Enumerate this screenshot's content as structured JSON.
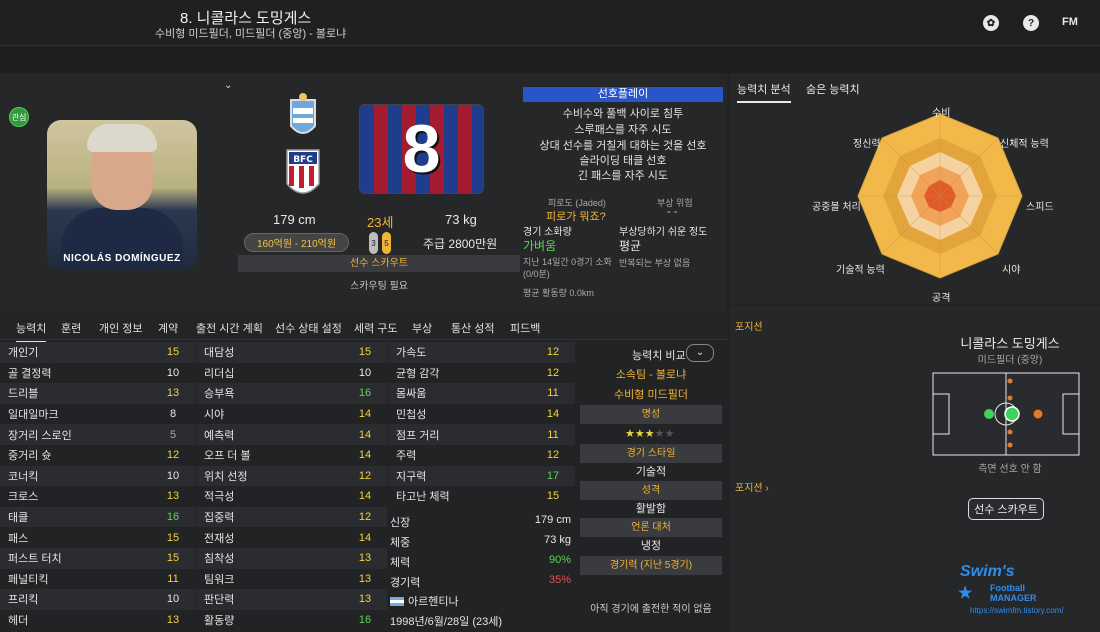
{
  "header": {
    "title": "8. 니콜라스 도밍게스",
    "subtitle": "수비형 미드필더, 미드필더 (중앙) - 볼로냐",
    "icons": [
      "award-icon",
      "help-icon",
      "fm-icon"
    ],
    "fm_label": "FM"
  },
  "profile": {
    "badge": "관심",
    "portrait_name": "NICOLÁS DOMÍNGUEZ",
    "shirt_number": "8",
    "height": "179 cm",
    "age": "23세",
    "weight": "73 kg",
    "value": "160억원 - 210억원",
    "reputation": [
      "3",
      "5"
    ],
    "wage": "주급 2800만원",
    "scout_label": "선수 스카우트",
    "scout_need": "스카우팅 필요"
  },
  "preferred_moves": {
    "title": "선호플레이",
    "items": [
      "수비수와 풀백 사이로 침투",
      "스루패스를 자주 시도",
      "상대 선수를 거칠게 대하는 것을 선호",
      "슬라이딩 태클 선호",
      "긴 패스를 자주 시도"
    ]
  },
  "status": {
    "fatigue_label": "피로도 (Jaded)",
    "fatigue_value": "피로가 뭐죠?",
    "injury_risk_label": "부상 위험",
    "injury_risk_value": "- -",
    "match_load_label": "경기 소화량",
    "match_load_value": "가벼움",
    "injury_prone_label": "부상당하기 쉬운 정도",
    "injury_prone_value": "평균",
    "recent_label": "지난 14일간 0경기 소화(0/0분)",
    "recurring_label": "반복되는 부상 없음",
    "avg_distance": "평균 활동량 0.0km"
  },
  "right_tabs": [
    "능력치 분석",
    "숨은 능력치"
  ],
  "radar_labels": {
    "defending": "수비",
    "physical": "신체적 능력",
    "speed": "스피드",
    "vision": "시야",
    "attacking": "공격",
    "technique": "기술적 능력",
    "aerial": "공중볼 처리",
    "mental": "정신력"
  },
  "positions": {
    "title": "포지션",
    "player_name": "니콜라스 도밍게스",
    "role": "미드필더 (중앙)",
    "note": "측면 선호 안 함",
    "title2": "포지션 ›",
    "scout_button": "선수 스카우트"
  },
  "logo": {
    "line1": "Swim's",
    "line2": "Football",
    "line3": "MANAGER",
    "url": "https://swimfm.tistory.com/"
  },
  "tabs": [
    "능력치",
    "훈련",
    "개인 정보",
    "계약",
    "출전 시간 계획",
    "선수 상태 설정",
    "세력 구도",
    "부상",
    "통산 성적",
    "피드백"
  ],
  "technical": [
    {
      "name": "개인기",
      "value": "15"
    },
    {
      "name": "골 결정력",
      "value": "10"
    },
    {
      "name": "드리블",
      "value": "13"
    },
    {
      "name": "일대일마크",
      "value": "8"
    },
    {
      "name": "장거리 스로인",
      "value": "5"
    },
    {
      "name": "중거리 슛",
      "value": "12"
    },
    {
      "name": "코너킥",
      "value": "10"
    },
    {
      "name": "크로스",
      "value": "13"
    },
    {
      "name": "태클",
      "value": "16"
    },
    {
      "name": "패스",
      "value": "15"
    },
    {
      "name": "퍼스트 터치",
      "value": "15"
    },
    {
      "name": "페널티킥",
      "value": "11"
    },
    {
      "name": "프리킥",
      "value": "10"
    },
    {
      "name": "헤더",
      "value": "13"
    }
  ],
  "mental": [
    {
      "name": "대담성",
      "value": "15"
    },
    {
      "name": "리더십",
      "value": "10"
    },
    {
      "name": "승부욕",
      "value": "16"
    },
    {
      "name": "시야",
      "value": "14"
    },
    {
      "name": "예측력",
      "value": "14"
    },
    {
      "name": "오프 더 볼",
      "value": "14"
    },
    {
      "name": "위치 선정",
      "value": "12"
    },
    {
      "name": "적극성",
      "value": "14"
    },
    {
      "name": "집중력",
      "value": "12"
    },
    {
      "name": "전재성",
      "value": "14"
    },
    {
      "name": "침착성",
      "value": "13"
    },
    {
      "name": "팀워크",
      "value": "13"
    },
    {
      "name": "판단력",
      "value": "13"
    },
    {
      "name": "활동량",
      "value": "16"
    }
  ],
  "physical": [
    {
      "name": "가속도",
      "value": "12"
    },
    {
      "name": "균형 감각",
      "value": "12"
    },
    {
      "name": "몸싸움",
      "value": "11"
    },
    {
      "name": "민첩성",
      "value": "14"
    },
    {
      "name": "점프 거리",
      "value": "11"
    },
    {
      "name": "주력",
      "value": "12"
    },
    {
      "name": "지구력",
      "value": "17"
    },
    {
      "name": "타고난 체력",
      "value": "15"
    }
  ],
  "info": [
    {
      "name": "신장",
      "value": "179 cm"
    },
    {
      "name": "체중",
      "value": "73 kg"
    },
    {
      "name": "체력",
      "value": "90%"
    },
    {
      "name": "경기력",
      "value": "35%"
    }
  ],
  "nationality": "아르헨티나",
  "birth": "1998년/6월/28일 (23세)",
  "compare": {
    "title": "능력치 비교",
    "club": "소속팀 - 볼로냐",
    "position": "수비형 미드필더",
    "reputation_label": "명성",
    "stars_filled": 3,
    "stars_total": 5,
    "style_label": "경기 스타일",
    "style_value": "기술적",
    "personality_label": "성격",
    "personality_value": "활발함",
    "media_label": "언론 대처",
    "media_value": "냉정",
    "form_label": "경기력 (지난 5경기)",
    "form_value": "아직 경기에 출전한 적이 없음"
  },
  "colors": {
    "accent_blue": "#2a55c9",
    "yellow": "#f0d241",
    "green": "#5ed35b",
    "orange": "#f1b435",
    "red": "#e2504e"
  }
}
